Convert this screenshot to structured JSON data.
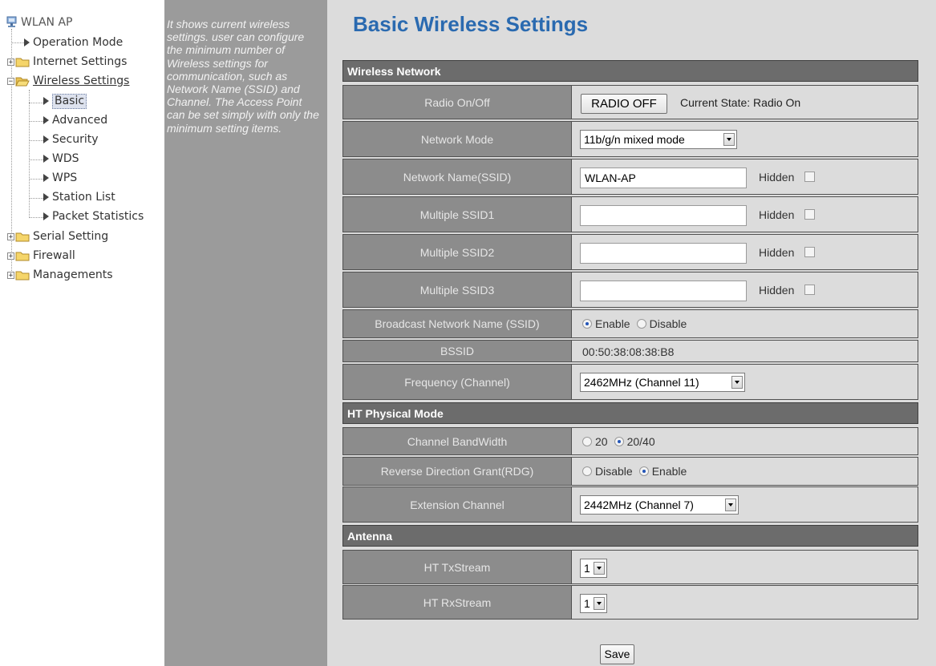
{
  "tree": {
    "root": "WLAN AP",
    "items": [
      {
        "label": "Operation Mode"
      },
      {
        "label": "Internet Settings"
      },
      {
        "label": "Wireless Settings"
      },
      {
        "label": "Basic"
      },
      {
        "label": "Advanced"
      },
      {
        "label": "Security"
      },
      {
        "label": "WDS"
      },
      {
        "label": "WPS"
      },
      {
        "label": "Station List"
      },
      {
        "label": "Packet Statistics"
      },
      {
        "label": "Serial Setting"
      },
      {
        "label": "Firewall"
      },
      {
        "label": "Managements"
      }
    ],
    "expander_plus": "+",
    "expander_minus": "−"
  },
  "description": "It shows current wireless settings. user can configure the minimum number of Wireless settings for communication, such as Network Name (SSID) and Channel. The Access Point can be set simply with only the minimum setting items.",
  "page_title": "Basic Wireless Settings",
  "sections": {
    "wireless_network": "Wireless Network",
    "ht_physical": "HT Physical Mode",
    "antenna": "Antenna"
  },
  "rows": {
    "radio": {
      "label": "Radio On/Off",
      "button": "RADIO OFF",
      "state": "Current State: Radio On"
    },
    "network_mode": {
      "label": "Network Mode",
      "value": "11b/g/n mixed mode"
    },
    "ssid": {
      "label": "Network Name(SSID)",
      "value": "WLAN-AP",
      "hidden_label": "Hidden"
    },
    "mssid1": {
      "label": "Multiple SSID1",
      "value": "",
      "hidden_label": "Hidden"
    },
    "mssid2": {
      "label": "Multiple SSID2",
      "value": "",
      "hidden_label": "Hidden"
    },
    "mssid3": {
      "label": "Multiple SSID3",
      "value": "",
      "hidden_label": "Hidden"
    },
    "broadcast": {
      "label": "Broadcast Network Name (SSID)",
      "opt1": "Enable",
      "opt2": "Disable",
      "selected": "Enable"
    },
    "bssid": {
      "label": "BSSID",
      "value": "00:50:38:08:38:B8"
    },
    "frequency": {
      "label": "Frequency (Channel)",
      "value": "2462MHz (Channel 11)"
    },
    "bandwidth": {
      "label": "Channel BandWidth",
      "opt1": "20",
      "opt2": "20/40",
      "selected": "20/40"
    },
    "rdg": {
      "label": "Reverse Direction Grant(RDG)",
      "opt1": "Disable",
      "opt2": "Enable",
      "selected": "Enable"
    },
    "ext_channel": {
      "label": "Extension Channel",
      "value": "2442MHz (Channel 7)"
    },
    "tx": {
      "label": "HT TxStream",
      "value": "1"
    },
    "rx": {
      "label": "HT RxStream",
      "value": "1"
    }
  },
  "save_label": "Save",
  "colors": {
    "title": "#2a6ab0",
    "section_header": "#6c6c6c",
    "label_cell": "#8c8c8c",
    "desc_panel": "#9b9b9b",
    "background": "#dcdcdc",
    "folder": "#f5d56a"
  }
}
